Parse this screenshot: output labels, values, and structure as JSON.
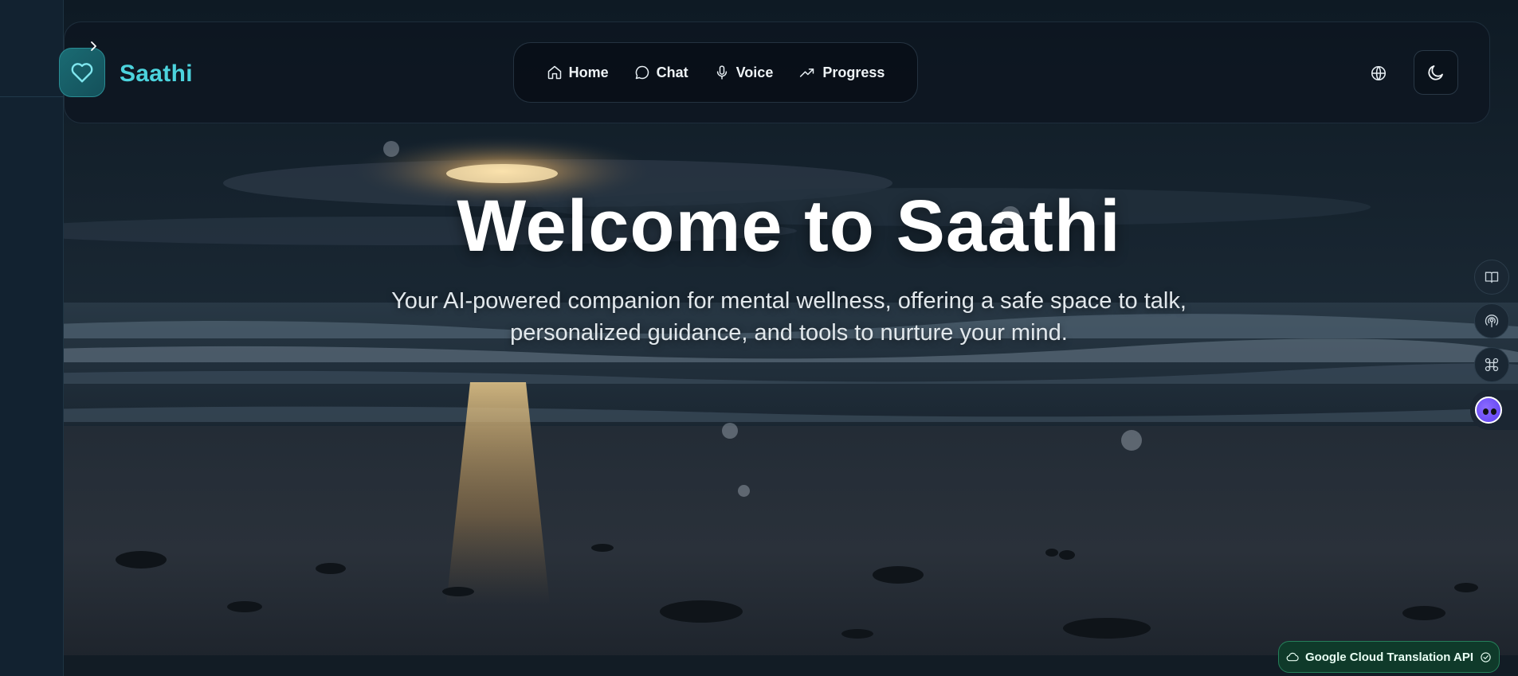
{
  "app": {
    "brand_name": "Saathi",
    "brand_color": "#4cd3dd"
  },
  "nav": {
    "items": [
      {
        "label": "Home",
        "icon": "home-icon"
      },
      {
        "label": "Chat",
        "icon": "chat-bubble-icon"
      },
      {
        "label": "Voice",
        "icon": "microphone-icon"
      },
      {
        "label": "Progress",
        "icon": "trending-up-icon"
      }
    ]
  },
  "header_actions": {
    "language_icon": "globe-icon",
    "theme_icon": "moon-icon"
  },
  "hero": {
    "title": "Welcome to Saathi",
    "subtitle": "Your AI-powered companion for mental wellness, offering a safe space to talk, personalized guidance, and tools to nurture your mind."
  },
  "side_tools": [
    {
      "icon": "book-icon"
    },
    {
      "icon": "broadcast-icon"
    },
    {
      "icon": "grid-command-icon"
    },
    {
      "icon": "assistant-avatar-icon"
    }
  ],
  "status_badge": {
    "label": "Google Cloud Translation API",
    "icon": "cloud-icon",
    "status_icon": "check-circle-icon",
    "color": "#25805a"
  }
}
